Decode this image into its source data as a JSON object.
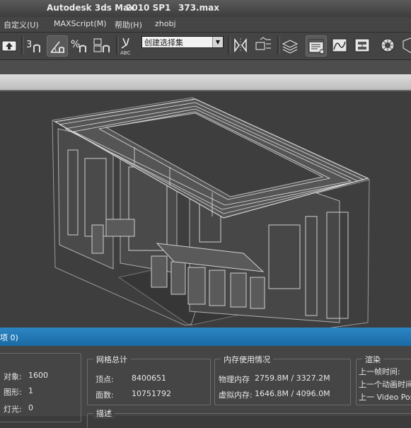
{
  "window": {
    "app_name": "Autodesk 3ds Max",
    "version": "2010 SP1",
    "file_name": "373.max"
  },
  "menu": {
    "items": [
      {
        "label": "自定义(U)"
      },
      {
        "label": "MAXScript(M)"
      },
      {
        "label": "帮助(H)"
      },
      {
        "label": "zhobj"
      }
    ]
  },
  "toolbar": {
    "selection_set_placeholder": "创建选择集",
    "snap_label": "3",
    "icons": [
      "import-icon",
      "snap-3d-icon",
      "angle-snap-icon",
      "percent-snap-icon",
      "spinner-snap-icon",
      "edit-named-selection-icon",
      "abc-icon",
      "mirror-icon",
      "align-icon",
      "layers-icon",
      "scene-explorer-icon",
      "curve-editor-icon",
      "schematic-view-icon",
      "material-editor-icon",
      "render-setup-icon"
    ]
  },
  "status_panel": {
    "title": "项 0)",
    "scene_group": {
      "objects_label": "对象:",
      "objects_value": "1600",
      "shapes_label": "图形:",
      "shapes_value": "1",
      "lights_label": "灯光:",
      "lights_value": "0"
    },
    "mesh_group": {
      "title": "网格总计",
      "vertices_label": "顶点:",
      "vertices_value": "8400651",
      "faces_label": "面数:",
      "faces_value": "10751792"
    },
    "memory_group": {
      "title": "内存使用情况",
      "physical_label": "物理内存",
      "physical_value": "2759.8M / 3327.2M",
      "virtual_label": "虚拟内存:",
      "virtual_value": "1646.8M / 4096.0M"
    },
    "render_group": {
      "title": "渲染",
      "last_frame_label": "上一帧时间:",
      "last_anim_label": "上一个动画时间",
      "last_video_label": "上一 Video Post"
    },
    "description_title": "描述"
  }
}
